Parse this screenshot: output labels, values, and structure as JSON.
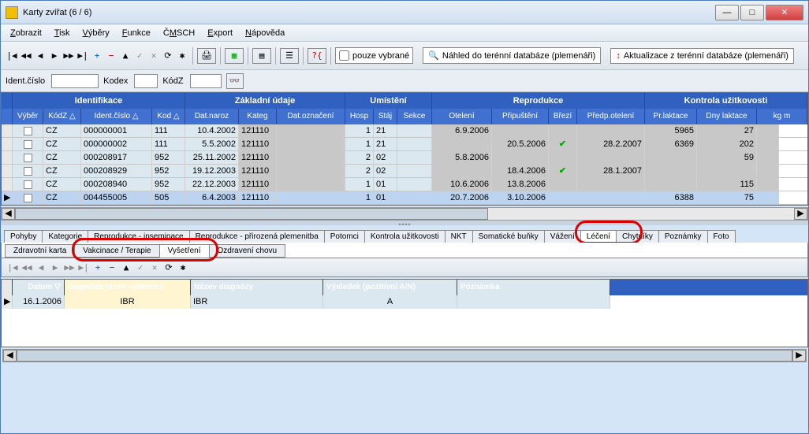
{
  "window": {
    "title": "Karty zvířat (6 / 6)"
  },
  "menu": [
    "Zobrazit",
    "Tisk",
    "Výběry",
    "Funkce",
    "ČMSCH",
    "Export",
    "Nápověda"
  ],
  "toolbar": {
    "checkbox": "pouze vybrané",
    "btn1": "Náhled do terénní databáze (plemenáři)",
    "btn2": "Aktualizace z terénní databáze (plemenáři)"
  },
  "filters": {
    "l1": "Ident.číslo",
    "l2": "Kodex",
    "l3": "KódZ"
  },
  "groups": [
    "Identifikace",
    "Základní údaje",
    "Umístění",
    "Reprodukce",
    "Kontrola užitkovosti"
  ],
  "cols": [
    "Výběr",
    "KódZ △",
    "Ident.číslo △",
    "Kod △",
    "Dat.naroz",
    "Kateg",
    "Dat.označení",
    "Hosp",
    "Stáj",
    "Sekce",
    "Otelení",
    "Připuštění",
    "Březí",
    "Předp.otelení",
    "Pr.laktace",
    "Dny laktace",
    "kg m"
  ],
  "rows": [
    {
      "kodz": "CZ",
      "ident": "000000001",
      "kod": "111",
      "dat": "10.4.2002",
      "kat": "121110",
      "hosp": "1",
      "staj": "21",
      "otel": "6.9.2006",
      "prip": "",
      "brez": "",
      "pred": "",
      "plak": "5965",
      "dlak": "27"
    },
    {
      "kodz": "CZ",
      "ident": "000000002",
      "kod": "111",
      "dat": "5.5.2002",
      "kat": "121110",
      "hosp": "1",
      "staj": "21",
      "otel": "",
      "prip": "20.5.2006",
      "brez": "✔",
      "pred": "28.2.2007",
      "plak": "6369",
      "dlak": "202"
    },
    {
      "kodz": "CZ",
      "ident": "000208917",
      "kod": "952",
      "dat": "25.11.2002",
      "kat": "121110",
      "hosp": "2",
      "staj": "02",
      "otel": "5.8.2006",
      "prip": "",
      "brez": "",
      "pred": "",
      "plak": "",
      "dlak": "59"
    },
    {
      "kodz": "CZ",
      "ident": "000208929",
      "kod": "952",
      "dat": "19.12.2003",
      "kat": "121110",
      "hosp": "2",
      "staj": "02",
      "otel": "",
      "prip": "18.4.2006",
      "brez": "✔",
      "pred": "28.1.2007",
      "plak": "",
      "dlak": ""
    },
    {
      "kodz": "CZ",
      "ident": "000208940",
      "kod": "952",
      "dat": "22.12.2003",
      "kat": "121110",
      "hosp": "1",
      "staj": "01",
      "otel": "10.6.2006",
      "prip": "13.8.2006",
      "brez": "",
      "pred": "",
      "plak": "",
      "dlak": "115"
    },
    {
      "kodz": "CZ",
      "ident": "004455005",
      "kod": "505",
      "dat": "6.4.2003",
      "kat": "121110",
      "hosp": "1",
      "staj": "01",
      "otel": "20.7.2006",
      "prip": "3.10.2006",
      "brez": "",
      "pred": "",
      "plak": "6388",
      "dlak": "75"
    }
  ],
  "tabs1": [
    "Pohyby",
    "Kategorie",
    "Reprodukce - inseminace",
    "Reprodukce - přirozená plemenitba",
    "Potomci",
    "Kontrola užitkovosti",
    "NKT",
    "Somatické buňky",
    "Vážení",
    "Léčení",
    "Chytníky",
    "Poznámky",
    "Foto"
  ],
  "tabs1_active": 9,
  "tabs2": [
    "Zdravotní karta",
    "Vakcinace / Terapie",
    "Vyšetření",
    "Ozdravení chovu"
  ],
  "tabs2_active": 2,
  "lcols": [
    "Datum ▽",
    "Diagnóza (druh vyšetření)",
    "Název diagnózy",
    "Výsledek (pozitivní A/N)",
    "Poznámka"
  ],
  "lrow": {
    "dat": "16.1.2006",
    "diag": "IBR",
    "naz": "IBR",
    "vys": "A",
    "poz": ""
  }
}
